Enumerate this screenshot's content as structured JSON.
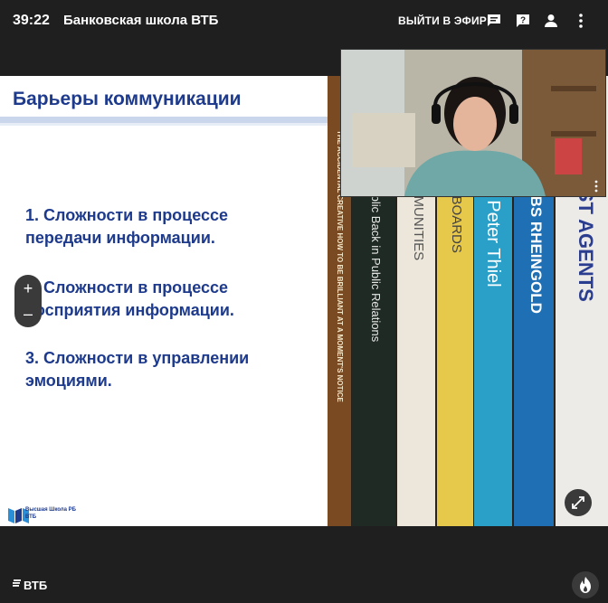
{
  "header": {
    "timer": "39:22",
    "title": "Банковская школа ВТБ",
    "go_live": "ВЫЙТИ В ЭФИР",
    "icons": [
      "chat-icon",
      "question-icon",
      "person-icon",
      "more-vert-icon"
    ]
  },
  "slide": {
    "title": "Барьеры коммуникации",
    "points": [
      [
        "1. Сложности в процессе",
        "передачи информации."
      ],
      [
        "2. Сложности в процессе",
        "восприятия информации."
      ],
      [
        "3. Сложности в управлении",
        "эмоциями."
      ]
    ],
    "logo_text": "Высшая Школа РБ ВТБ"
  },
  "books": [
    {
      "text": "THE ACCIDENTAL CREATIVE HOW TO BE BRILLIANT AT A MOMENT'S NOTICE",
      "bg": "#7a4a22",
      "fg": "#f2e6c8"
    },
    {
      "text": "Putting the Public Back in Public Relations",
      "bg": "#1f2a24",
      "fg": "#e8e8e8"
    },
    {
      "text": "STARTUP COMMUNITIES",
      "bg": "#ece7da",
      "fg": "#555"
    },
    {
      "text": "STARTUP BOARDS",
      "bg": "#e6c84a",
      "fg": "#444"
    },
    {
      "text": "ZERO to ONE  Peter Thiel",
      "bg": "#2aa0c8",
      "fg": "#fff"
    },
    {
      "text": "SMART MOBS  RHEINGOLD",
      "bg": "#1e6fb4",
      "fg": "#fff"
    },
    {
      "text": "SMITH TRUST AGENTS",
      "bg": "#ecebe7",
      "fg": "#2b3d8f"
    }
  ],
  "zoom": {
    "plus": "+",
    "minus": "–"
  },
  "footer": {
    "brand": "ВТБ"
  },
  "colors": {
    "accent": "#1d3a8c",
    "background": "#1f1f1f"
  }
}
